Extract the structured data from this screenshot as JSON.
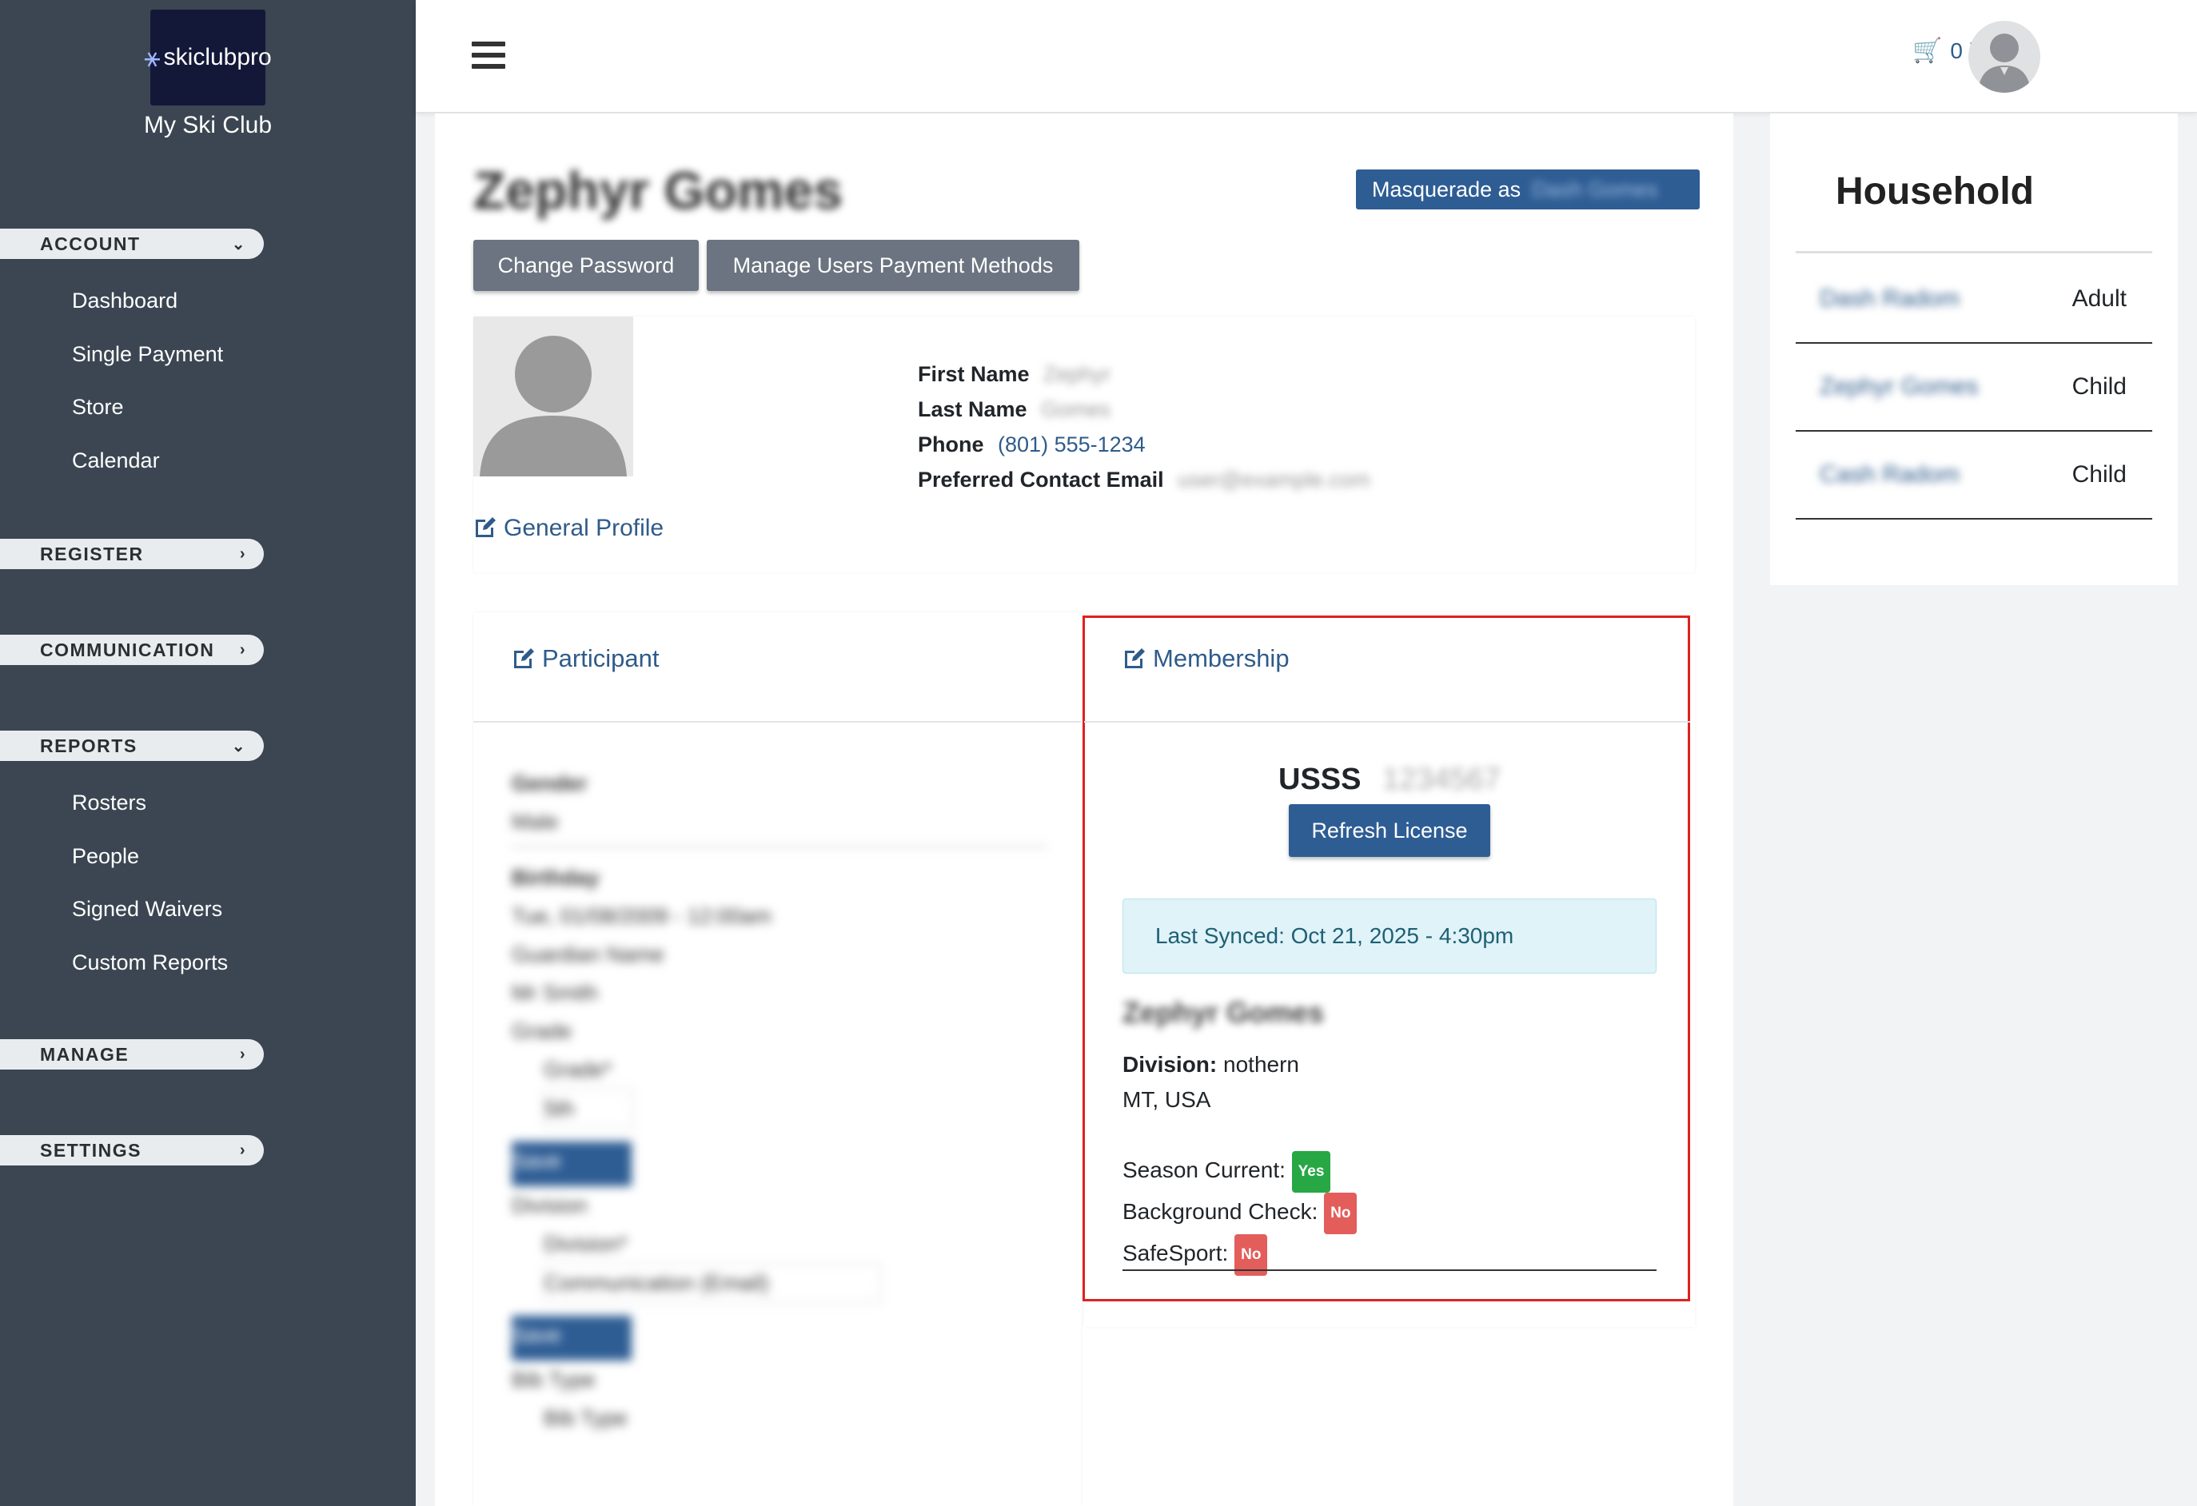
{
  "sidebar": {
    "logo_text": "skiclubpro",
    "club_name": "My Ski Club",
    "sections": [
      {
        "label": "ACCOUNT",
        "items": [
          "Dashboard",
          "Single Payment",
          "Store",
          "Calendar"
        ]
      },
      {
        "label": "REGISTER",
        "items": []
      },
      {
        "label": "COMMUNICATION",
        "items": []
      },
      {
        "label": "REPORTS",
        "items": [
          "Rosters",
          "People",
          "Signed Waivers",
          "Custom Reports"
        ]
      },
      {
        "label": "MANAGE",
        "items": []
      },
      {
        "label": "SETTINGS",
        "items": []
      }
    ]
  },
  "topbar": {
    "cart_label": "0 items"
  },
  "profile": {
    "name": "Zephyr Gomes",
    "masquerade_label": "Masquerade as",
    "masquerade_target": "Dash Gomes",
    "change_password": "Change Password",
    "manage_payment": "Manage Users Payment Methods",
    "first_name_label": "First Name",
    "first_name": "Zephyr",
    "last_name_label": "Last Name",
    "last_name": "Gomes",
    "phone_label": "Phone",
    "phone": "(801) 555-1234",
    "email_label": "Preferred Contact Email",
    "email": "user@example.com",
    "general_profile": "General Profile"
  },
  "participant": {
    "title": "Participant",
    "blurred_lines": [
      "Gender",
      "Male",
      "Birthday",
      "Tue, 01/08/2009 - 12:00am",
      "Guardian Name",
      "Mr Smith",
      "Grade",
      "Grade*",
      "5th",
      "Save",
      "Division",
      "Division*",
      "Communication (Email)",
      "Save",
      "Bib Type",
      "Bib Type"
    ]
  },
  "membership": {
    "title": "Membership",
    "org": "USSS",
    "license_number": "1234567",
    "refresh_label": "Refresh License",
    "last_synced": "Last Synced: Oct 21, 2025 - 4:30pm",
    "member_name": "Zephyr Gomes",
    "division_label": "Division:",
    "division_value": "nothern",
    "location": "MT, USA",
    "season_label": "Season Current:",
    "season_value": "Yes",
    "background_label": "Background Check:",
    "background_value": "No",
    "safesport_label": "SafeSport:",
    "safesport_value": "No"
  },
  "household": {
    "title": "Household",
    "members": [
      {
        "name": "Dash Radom",
        "role": "Adult"
      },
      {
        "name": "Zephyr Gomes",
        "role": "Child"
      },
      {
        "name": "Cash Radom",
        "role": "Child"
      }
    ]
  },
  "colors": {
    "sidebar_bg": "#3b4652",
    "primary": "#2e5d94",
    "link": "#2f5b8a",
    "success": "#28a745",
    "danger": "#e35d5b",
    "alert_info_bg": "#dff3f8",
    "highlight_border": "#e02020"
  }
}
